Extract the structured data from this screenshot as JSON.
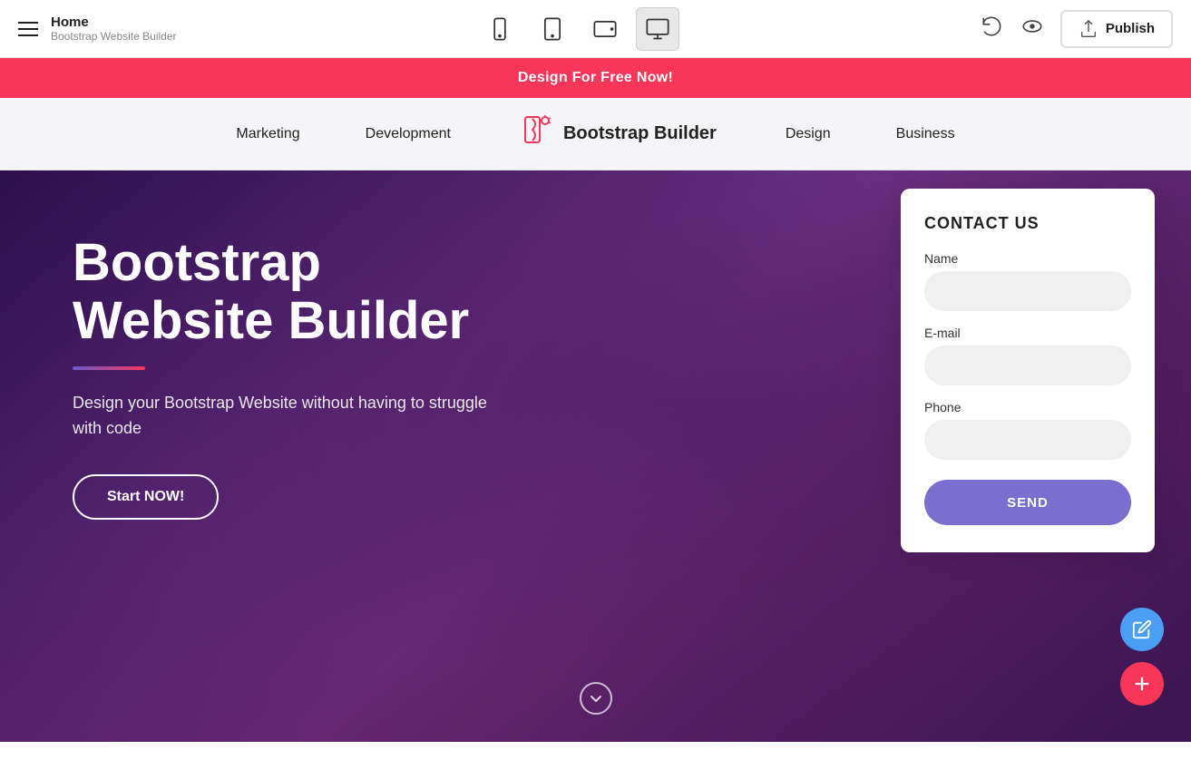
{
  "topbar": {
    "home_label": "Home",
    "subtitle": "Bootstrap Website Builder",
    "publish_label": "Publish"
  },
  "promo": {
    "text": "Design For Free Now!"
  },
  "nav": {
    "brand_text": "Bootstrap Builder",
    "links": [
      "Marketing",
      "Development",
      "Design",
      "Business"
    ]
  },
  "hero": {
    "title_line1": "Bootstrap",
    "title_line2": "Website Builder",
    "subtitle": "Design your Bootstrap Website without having to struggle with code",
    "cta_label": "Start NOW!"
  },
  "contact": {
    "title": "CONTACT US",
    "name_label": "Name",
    "name_placeholder": "",
    "email_label": "E-mail",
    "email_placeholder": "",
    "phone_label": "Phone",
    "phone_placeholder": "",
    "send_label": "SEND"
  },
  "devices": [
    {
      "id": "mobile",
      "label": "Mobile"
    },
    {
      "id": "tablet",
      "label": "Tablet"
    },
    {
      "id": "tablet-landscape",
      "label": "Tablet Landscape"
    },
    {
      "id": "desktop",
      "label": "Desktop"
    }
  ]
}
